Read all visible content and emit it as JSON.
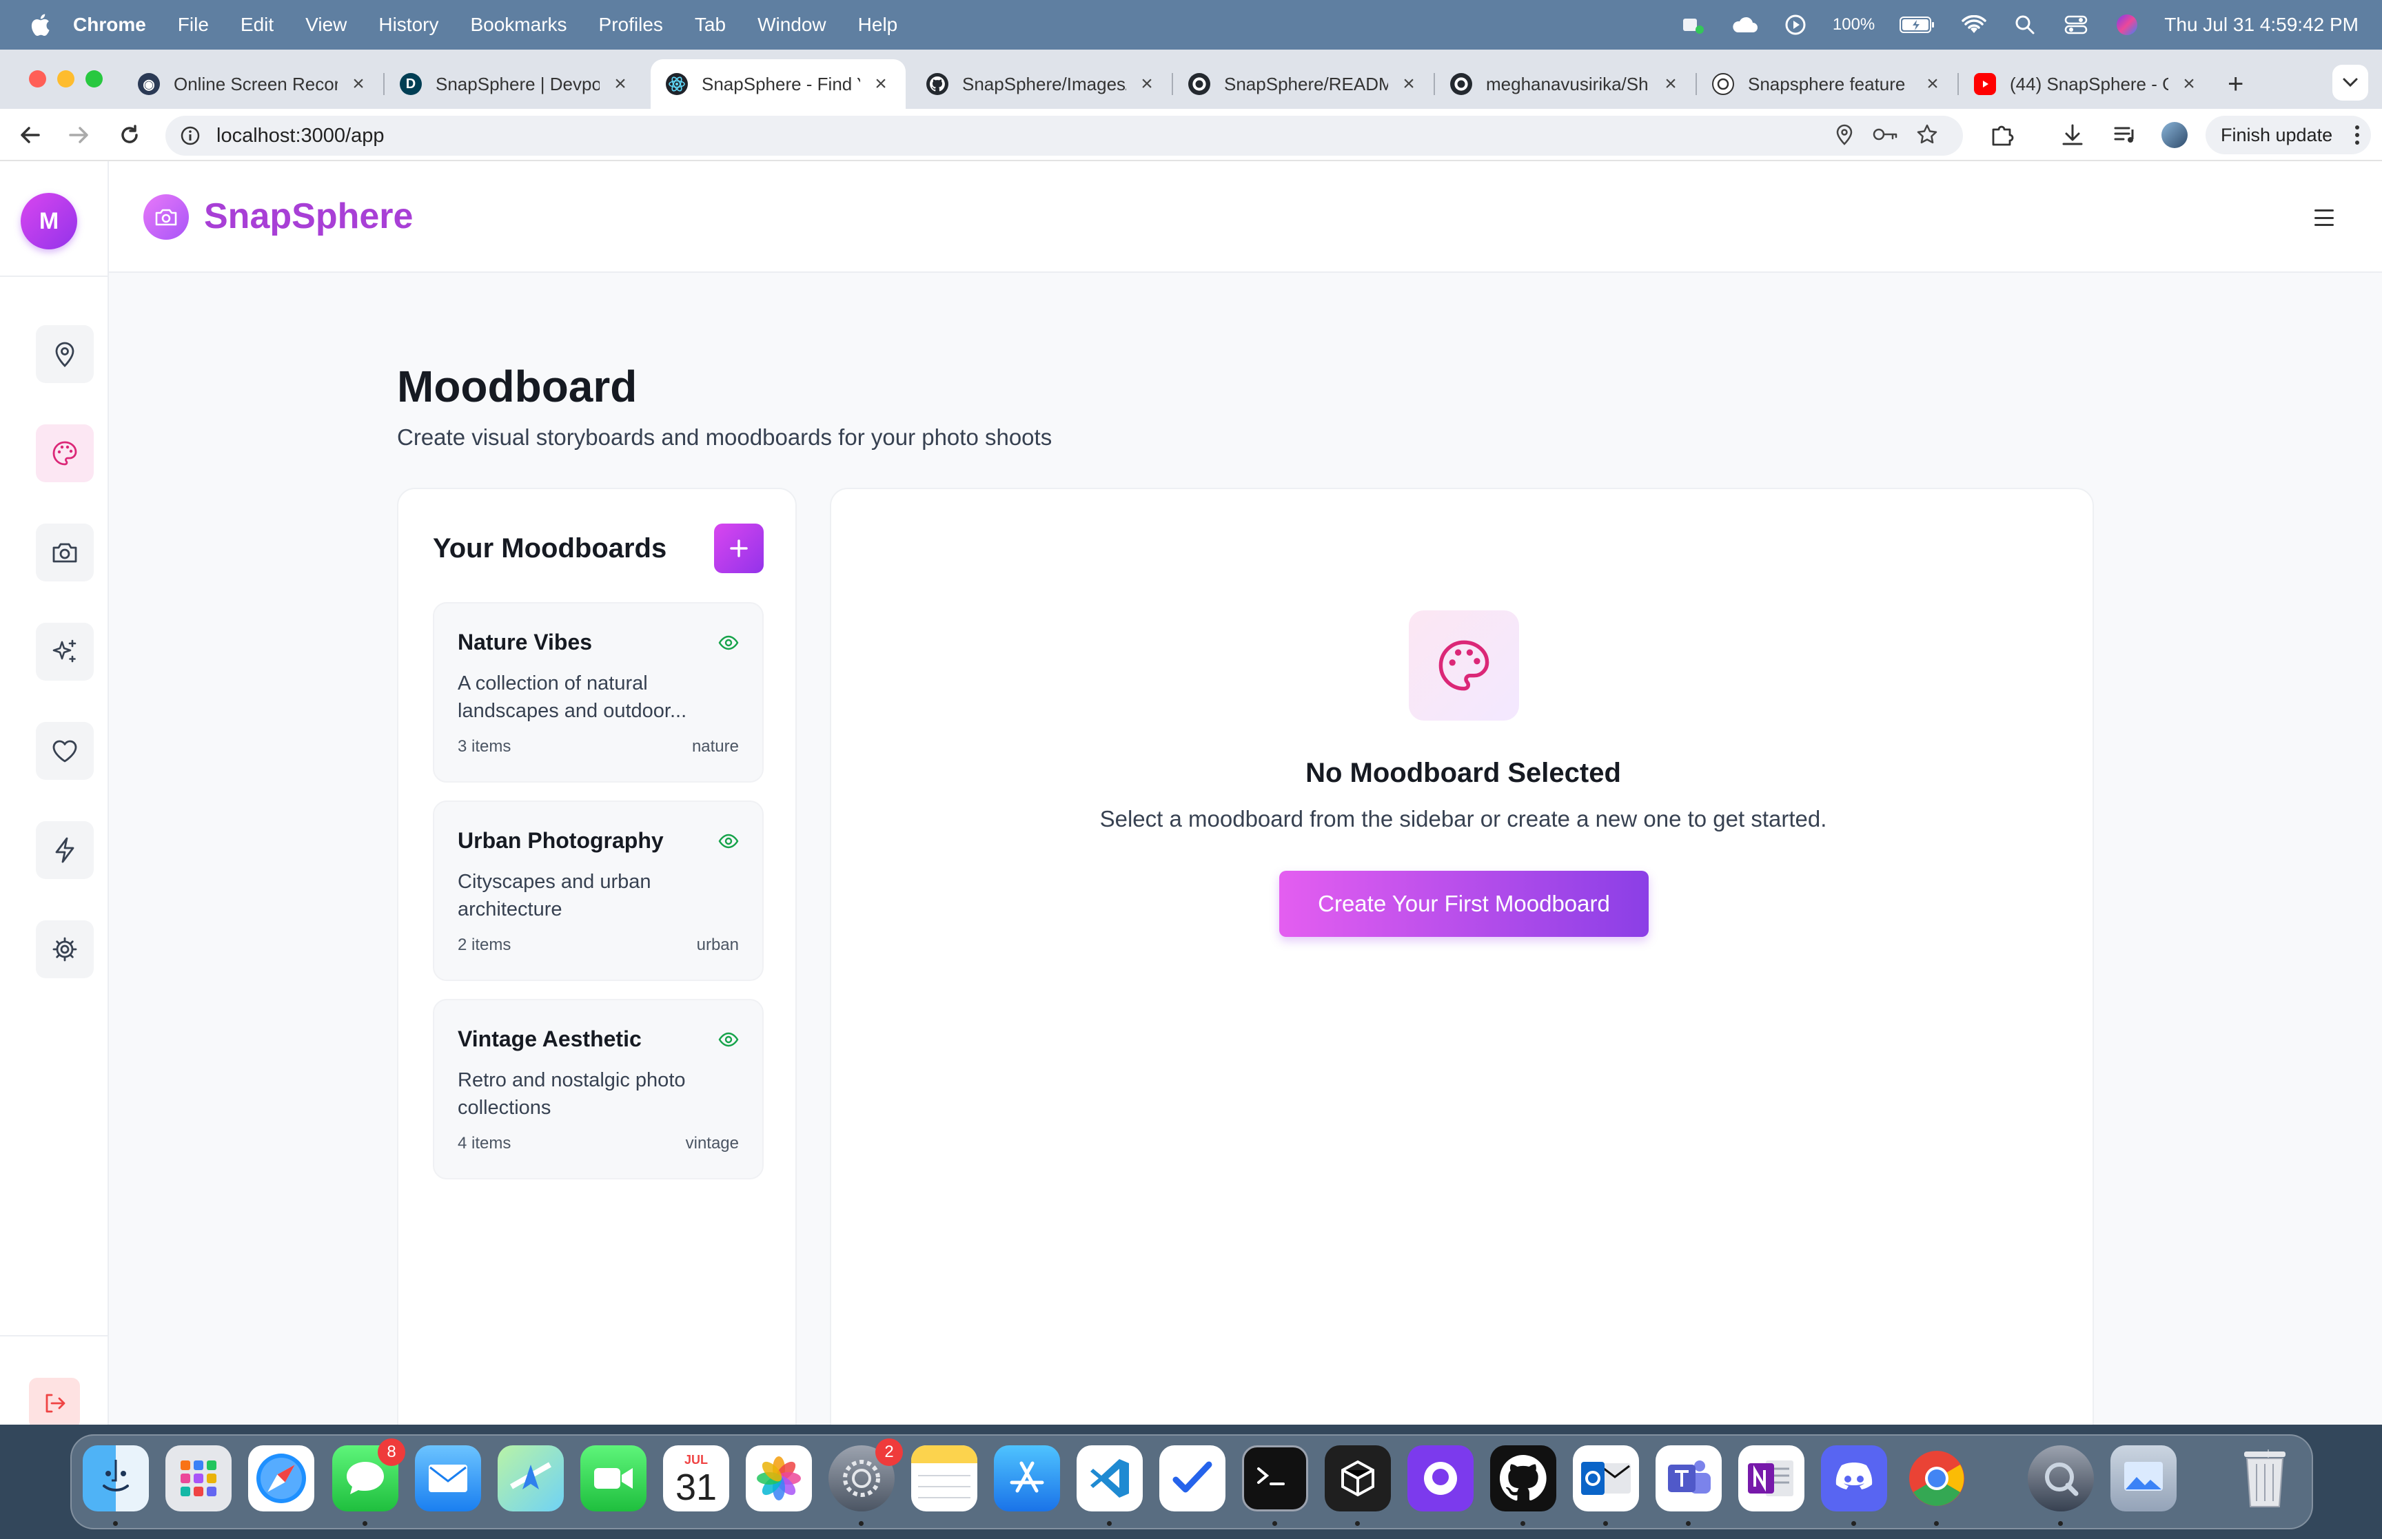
{
  "menubar": {
    "app_name": "Chrome",
    "menus": [
      "File",
      "Edit",
      "View",
      "History",
      "Bookmarks",
      "Profiles",
      "Tab",
      "Window",
      "Help"
    ],
    "battery": "100%",
    "clock": "Thu Jul 31  4:59:42 PM"
  },
  "browser": {
    "tabs": [
      {
        "title": "Online Screen Recor",
        "icon": "screen-recorder-icon"
      },
      {
        "title": "SnapSphere | Devpo",
        "icon": "devpost-icon"
      },
      {
        "title": "SnapSphere - Find Y",
        "icon": "react-icon",
        "active": true
      },
      {
        "title": "SnapSphere/Images/",
        "icon": "github-icon"
      },
      {
        "title": "SnapSphere/READM",
        "icon": "github-icon"
      },
      {
        "title": "meghanavusirika/Sh",
        "icon": "github-icon"
      },
      {
        "title": "Snapsphere feature",
        "icon": "openai-icon"
      },
      {
        "title": "(44) SnapSphere - G",
        "icon": "youtube-icon"
      }
    ],
    "url": "localhost:3000/app",
    "finish_update": "Finish update",
    "accent": "#a855f7"
  },
  "app": {
    "avatar_initial": "M",
    "brand": "SnapSphere",
    "nav": [
      {
        "name": "location",
        "icon": "map-pin-icon"
      },
      {
        "name": "moodboard",
        "icon": "palette-icon",
        "active": true
      },
      {
        "name": "camera",
        "icon": "camera-icon"
      },
      {
        "name": "ai",
        "icon": "sparkles-icon"
      },
      {
        "name": "favorites",
        "icon": "heart-icon"
      },
      {
        "name": "quick",
        "icon": "lightning-icon"
      },
      {
        "name": "settings",
        "icon": "gear-icon"
      }
    ],
    "page_title": "Moodboard",
    "page_subtitle": "Create visual storyboards and moodboards for your photo shoots",
    "list_title": "Your Moodboards",
    "moodboards": [
      {
        "name": "Nature Vibes",
        "desc": "A collection of natural landscapes and outdoor...",
        "count": "3 items",
        "tag": "nature"
      },
      {
        "name": "Urban Photography",
        "desc": "Cityscapes and urban architecture",
        "count": "2 items",
        "tag": "urban"
      },
      {
        "name": "Vintage Aesthetic",
        "desc": "Retro and nostalgic photo collections",
        "count": "4 items",
        "tag": "vintage"
      }
    ],
    "empty_title": "No Moodboard Selected",
    "empty_sub": "Select a moodboard from the sidebar or create a new one to get started.",
    "create_button": "Create Your First Moodboard"
  },
  "dock": {
    "messages_badge": "8",
    "settings_badge": "2",
    "calendar_month": "JUL",
    "calendar_day": "31"
  }
}
